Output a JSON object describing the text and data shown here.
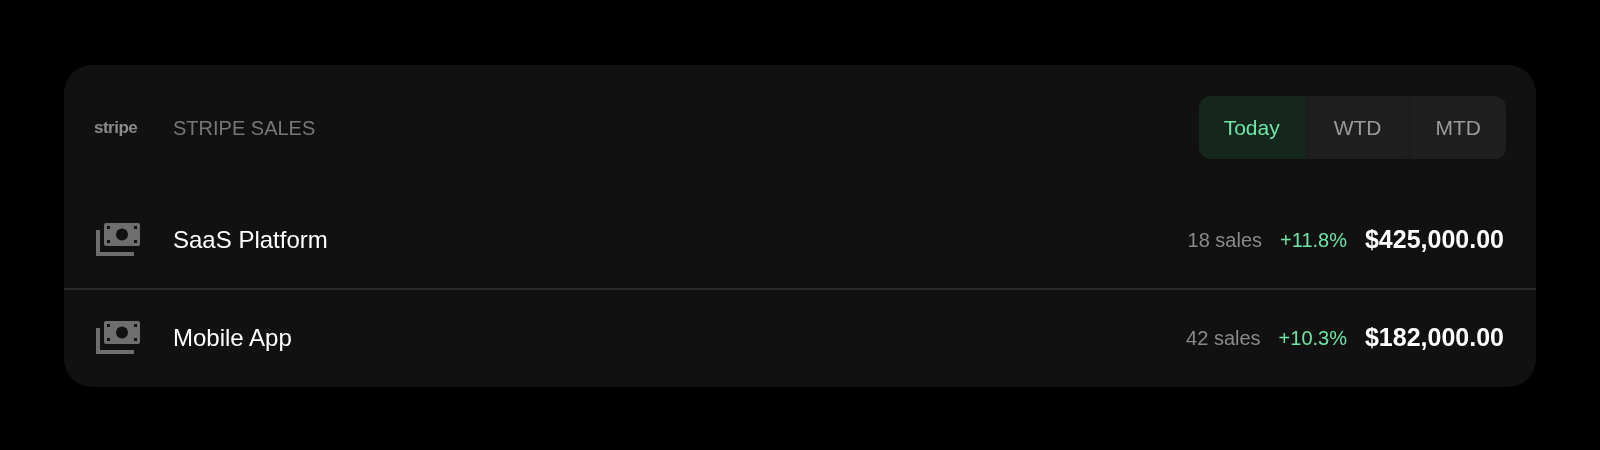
{
  "header": {
    "logo": "stripe",
    "title": "STRIPE SALES"
  },
  "tabs": [
    {
      "label": "Today",
      "selected": true
    },
    {
      "label": "WTD",
      "selected": false
    },
    {
      "label": "MTD",
      "selected": false
    }
  ],
  "rows": [
    {
      "name": "SaaS Platform",
      "sales": "18 sales",
      "change": "+11.8%",
      "amount": "$425,000.00"
    },
    {
      "name": "Mobile App",
      "sales": "42 sales",
      "change": "+10.3%",
      "amount": "$182,000.00"
    }
  ]
}
